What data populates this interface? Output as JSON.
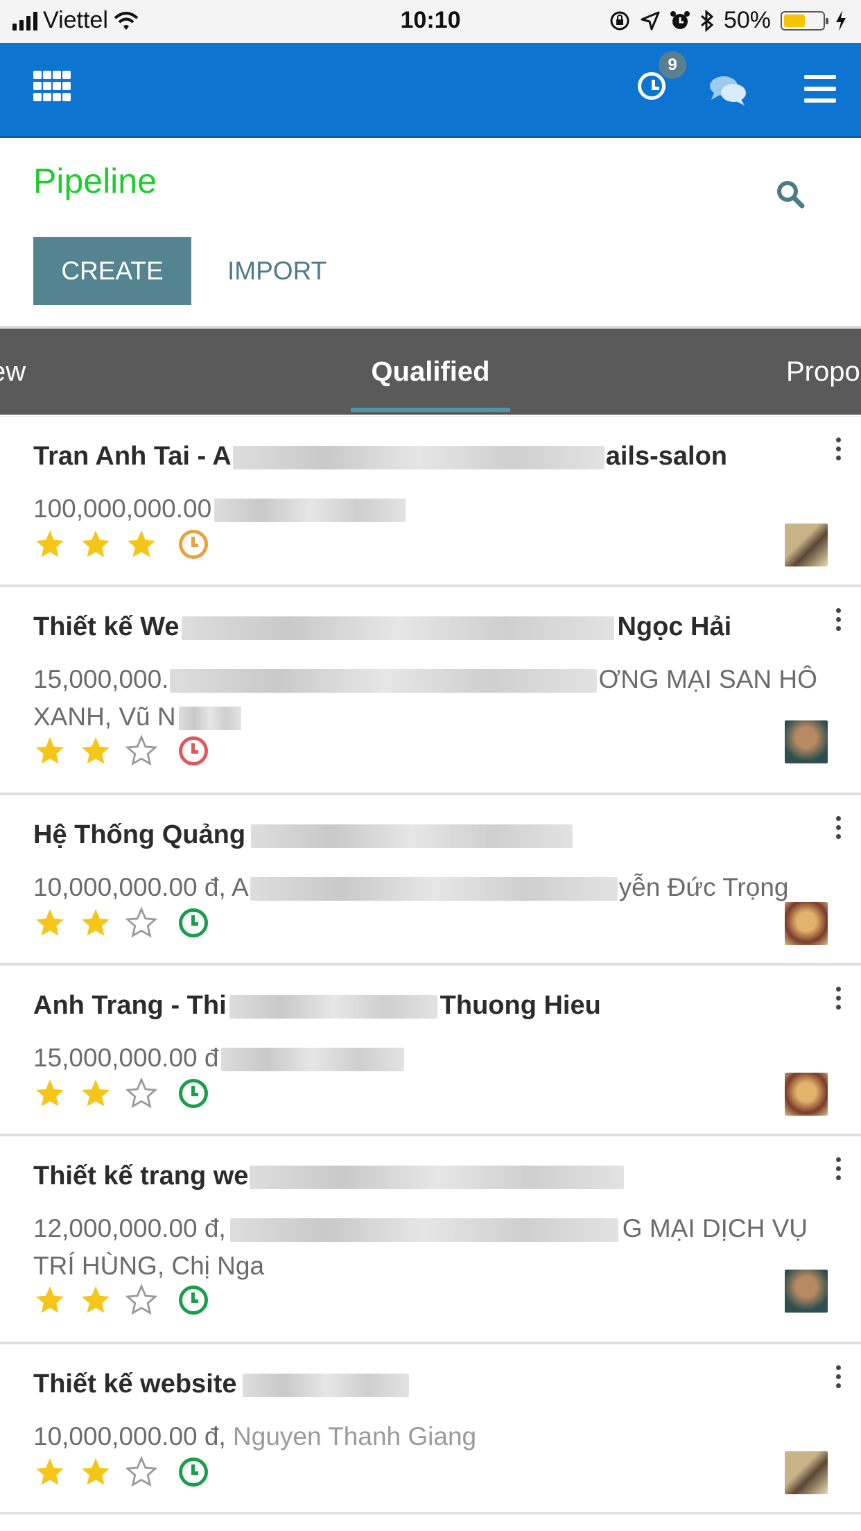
{
  "status_bar": {
    "carrier": "Viettel",
    "time": "10:10",
    "battery": "50%",
    "battery_level": 0.5
  },
  "navbar": {
    "activity_badge": "9"
  },
  "control_panel": {
    "title": "Pipeline",
    "create_label": "CREATE",
    "import_label": "IMPORT"
  },
  "stages": {
    "prev": "ew",
    "active": "Qualified",
    "next": "Propo"
  },
  "cards": [
    {
      "title_start": "Tran Anh Tai - A",
      "title_end": "ails-salon",
      "sub_start": "100,000,000.00",
      "sub_end": "",
      "stars": 3,
      "activity_color": "#e8a33d",
      "avatar_colors": [
        "#c9b48a",
        "#5a4634"
      ]
    },
    {
      "title_start": "Thiết kế We",
      "title_end": "Ngọc Hải",
      "sub_start": "15,000,000.",
      "sub_end": "ƠNG MẠI SAN HÔ XANH, Vũ N",
      "stars": 2,
      "activity_color": "#e0575b",
      "avatar_colors": [
        "#b88a63",
        "#2f4f4f"
      ]
    },
    {
      "title_start": "Hệ Thống Quảng",
      "title_end": "",
      "sub_start": "10,000,000.00 đ, A",
      "sub_end": "yễn Đức Trọng",
      "stars": 2,
      "activity_color": "#1a9e4b",
      "avatar_colors": [
        "#e2b36a",
        "#7a3b2a"
      ]
    },
    {
      "title_start": "Anh Trang - Thi",
      "title_end": "Thuong Hieu",
      "sub_start": "15,000,000.00 đ",
      "sub_end": "",
      "stars": 2,
      "activity_color": "#1a9e4b",
      "avatar_colors": [
        "#e2b36a",
        "#7a3b2a"
      ]
    },
    {
      "title_start": "Thiết kế trang we",
      "title_end": "",
      "sub_start": "12,000,000.00 đ,",
      "sub_end": "G MẠI DỊCH VỤ TRÍ HÙNG, Chị Nga",
      "stars": 2,
      "activity_color": "#1a9e4b",
      "avatar_colors": [
        "#b88a63",
        "#2f4f4f"
      ]
    },
    {
      "title_start": "Thiết kế website",
      "title_end": "",
      "sub_start": "10,000,000.00 đ,",
      "sub_end": "Nguyen Thanh Giang",
      "stars": 2,
      "activity_color": "#1a9e4b",
      "avatar_colors": [
        "#c9b48a",
        "#5a4634"
      ]
    }
  ]
}
